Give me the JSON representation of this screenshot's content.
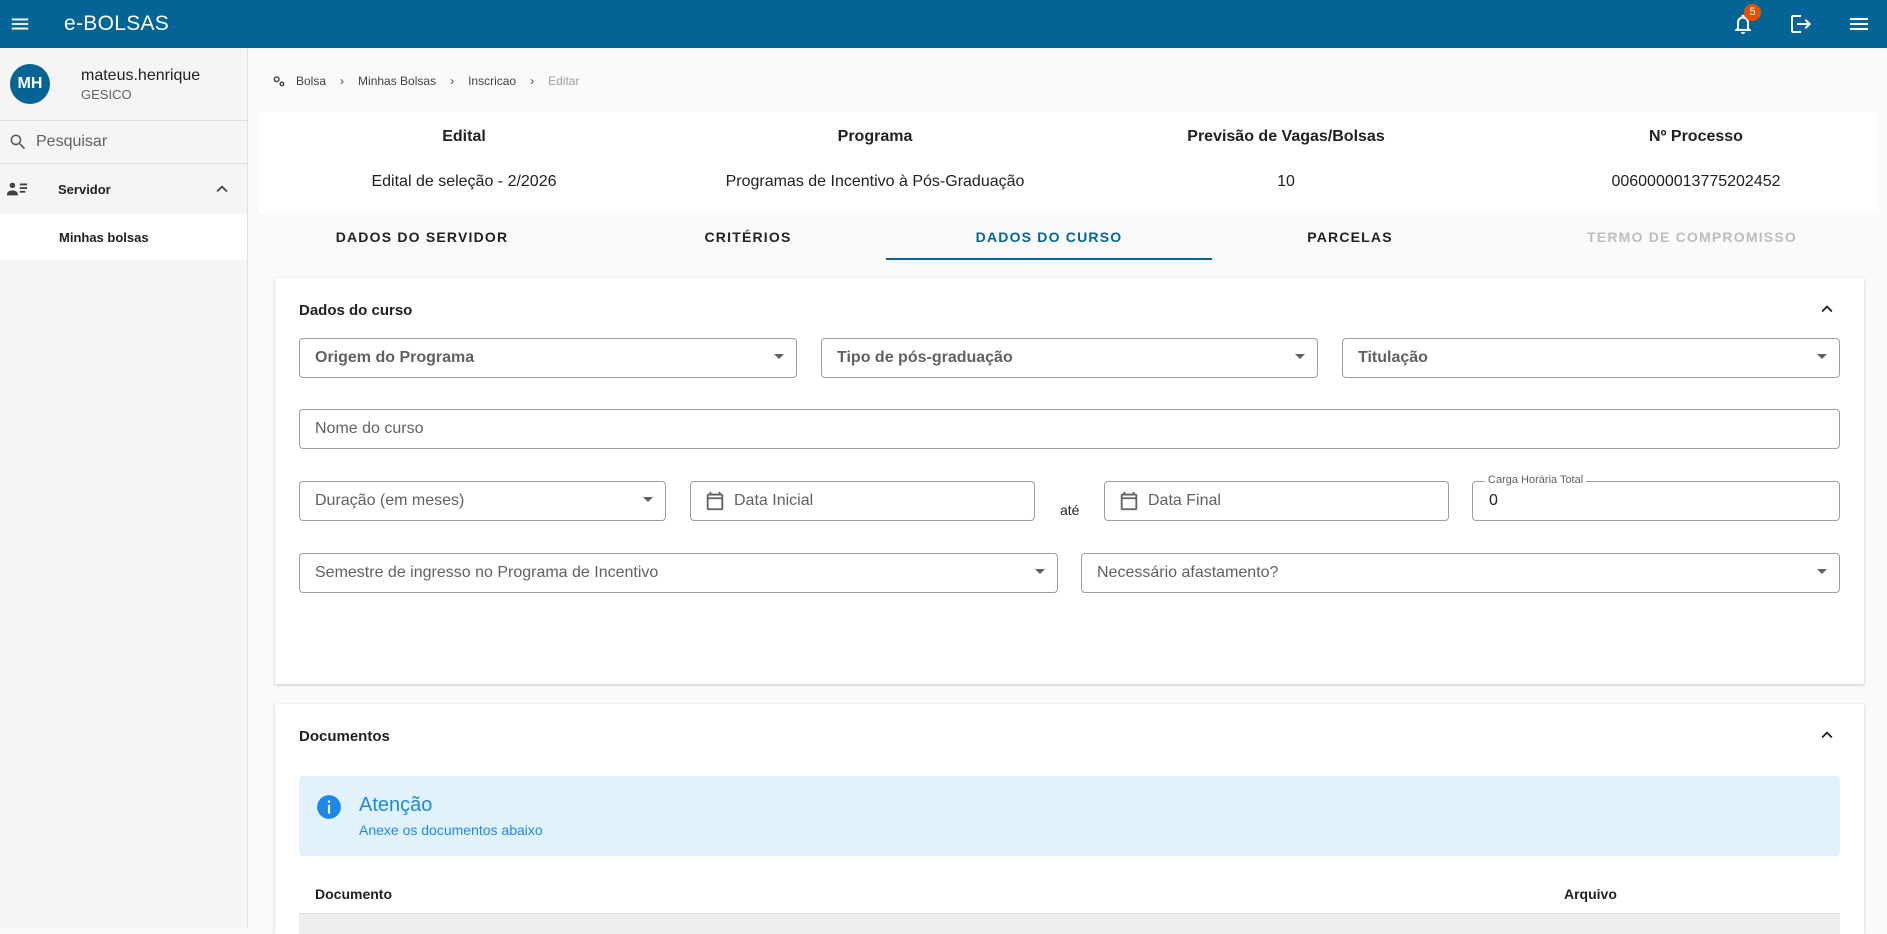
{
  "app": {
    "title": "e-BOLSAS",
    "notification_count": "5"
  },
  "user": {
    "initials": "MH",
    "name": "mateus.henrique",
    "org": "GESICO"
  },
  "sidebar": {
    "search_placeholder": "Pesquisar",
    "section_label": "Servidor",
    "items": [
      {
        "label": "Minhas bolsas"
      }
    ]
  },
  "breadcrumb": [
    "Bolsa",
    "Minhas Bolsas",
    "Inscricao",
    "Editar"
  ],
  "info": {
    "edital_header": "Edital",
    "edital_value": "Edital de seleção - 2/2026",
    "programa_header": "Programa",
    "programa_value": "Programas de Incentivo à Pós-Graduação",
    "vagas_header": "Previsão de Vagas/Bolsas",
    "vagas_value": "10",
    "processo_header": "Nº Processo",
    "processo_value": "0060000013775202452"
  },
  "tabs": [
    {
      "label": "DADOS DO SERVIDOR"
    },
    {
      "label": "CRITÉRIOS"
    },
    {
      "label": "DADOS DO CURSO"
    },
    {
      "label": "PARCELAS"
    },
    {
      "label": "TERMO DE COMPROMISSO"
    }
  ],
  "curso": {
    "title": "Dados do curso",
    "origem": "Origem do Programa",
    "tipo": "Tipo de pós-graduação",
    "titulacao": "Titulação",
    "nome": "Nome do curso",
    "duracao": "Duração (em meses)",
    "data_inicial": "Data Inicial",
    "ate": "até",
    "data_final": "Data Final",
    "carga_label": "Carga Horária Total",
    "carga_value": "0",
    "semestre": "Semestre de ingresso no Programa de Incentivo",
    "afastamento": "Necessário afastamento?"
  },
  "documentos": {
    "title": "Documentos",
    "alert_title": "Atenção",
    "alert_text": "Anexe os documentos abaixo",
    "col_documento": "Documento",
    "col_arquivo": "Arquivo"
  }
}
